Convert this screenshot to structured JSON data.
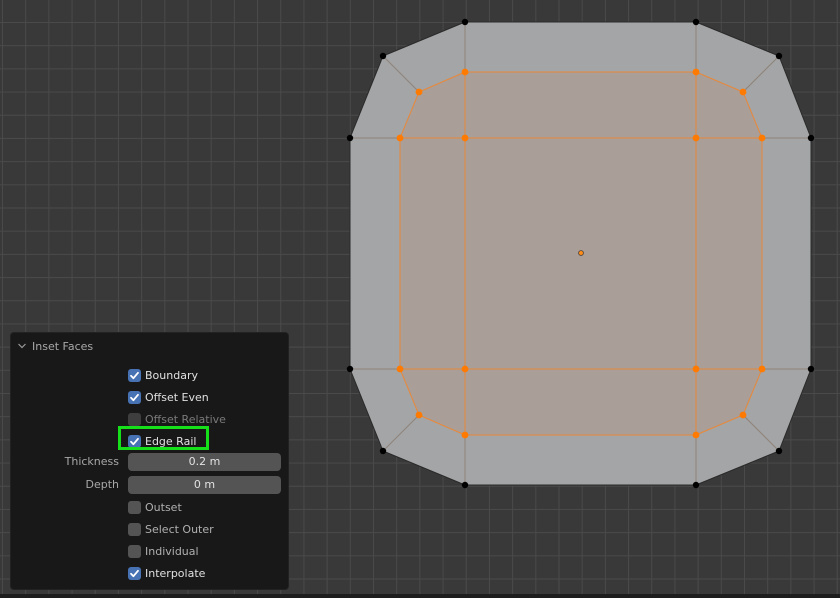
{
  "viewport": {
    "name": "3D Viewport",
    "mode": "Edit Mode",
    "colors": {
      "background": "#393939",
      "grid": "#4a4a4a",
      "face": "#a4a5a6",
      "selected_face": "#a99e98",
      "selected_edge": "#e8883a",
      "selected_vertex": "#ff7a00",
      "unselected_vertex": "#000000"
    },
    "mesh": {
      "outer_vertices_selected": false,
      "inner_vertices_selected": true,
      "selected_face_count": 9,
      "origin_marker": "object-origin-icon"
    }
  },
  "operator_panel": {
    "title": "Inset Faces",
    "collapse_icon": "chevron-down-icon",
    "options": [
      {
        "key": "boundary",
        "label": "Boundary",
        "checked": true,
        "enabled": true
      },
      {
        "key": "offset_even",
        "label": "Offset Even",
        "checked": true,
        "enabled": true
      },
      {
        "key": "offset_relative",
        "label": "Offset Relative",
        "checked": false,
        "enabled": false
      },
      {
        "key": "edge_rail",
        "label": "Edge Rail",
        "checked": true,
        "enabled": true,
        "highlighted": true
      }
    ],
    "fields": [
      {
        "key": "thickness",
        "label": "Thickness",
        "value": "0.2 m"
      },
      {
        "key": "depth",
        "label": "Depth",
        "value": "0 m"
      }
    ],
    "options2": [
      {
        "key": "outset",
        "label": "Outset",
        "checked": false,
        "enabled": true
      },
      {
        "key": "select_outer",
        "label": "Select Outer",
        "checked": false,
        "enabled": true
      },
      {
        "key": "individual",
        "label": "Individual",
        "checked": false,
        "enabled": true
      },
      {
        "key": "interpolate",
        "label": "Interpolate",
        "checked": true,
        "enabled": true
      }
    ],
    "highlight_color": "#16e01a"
  }
}
